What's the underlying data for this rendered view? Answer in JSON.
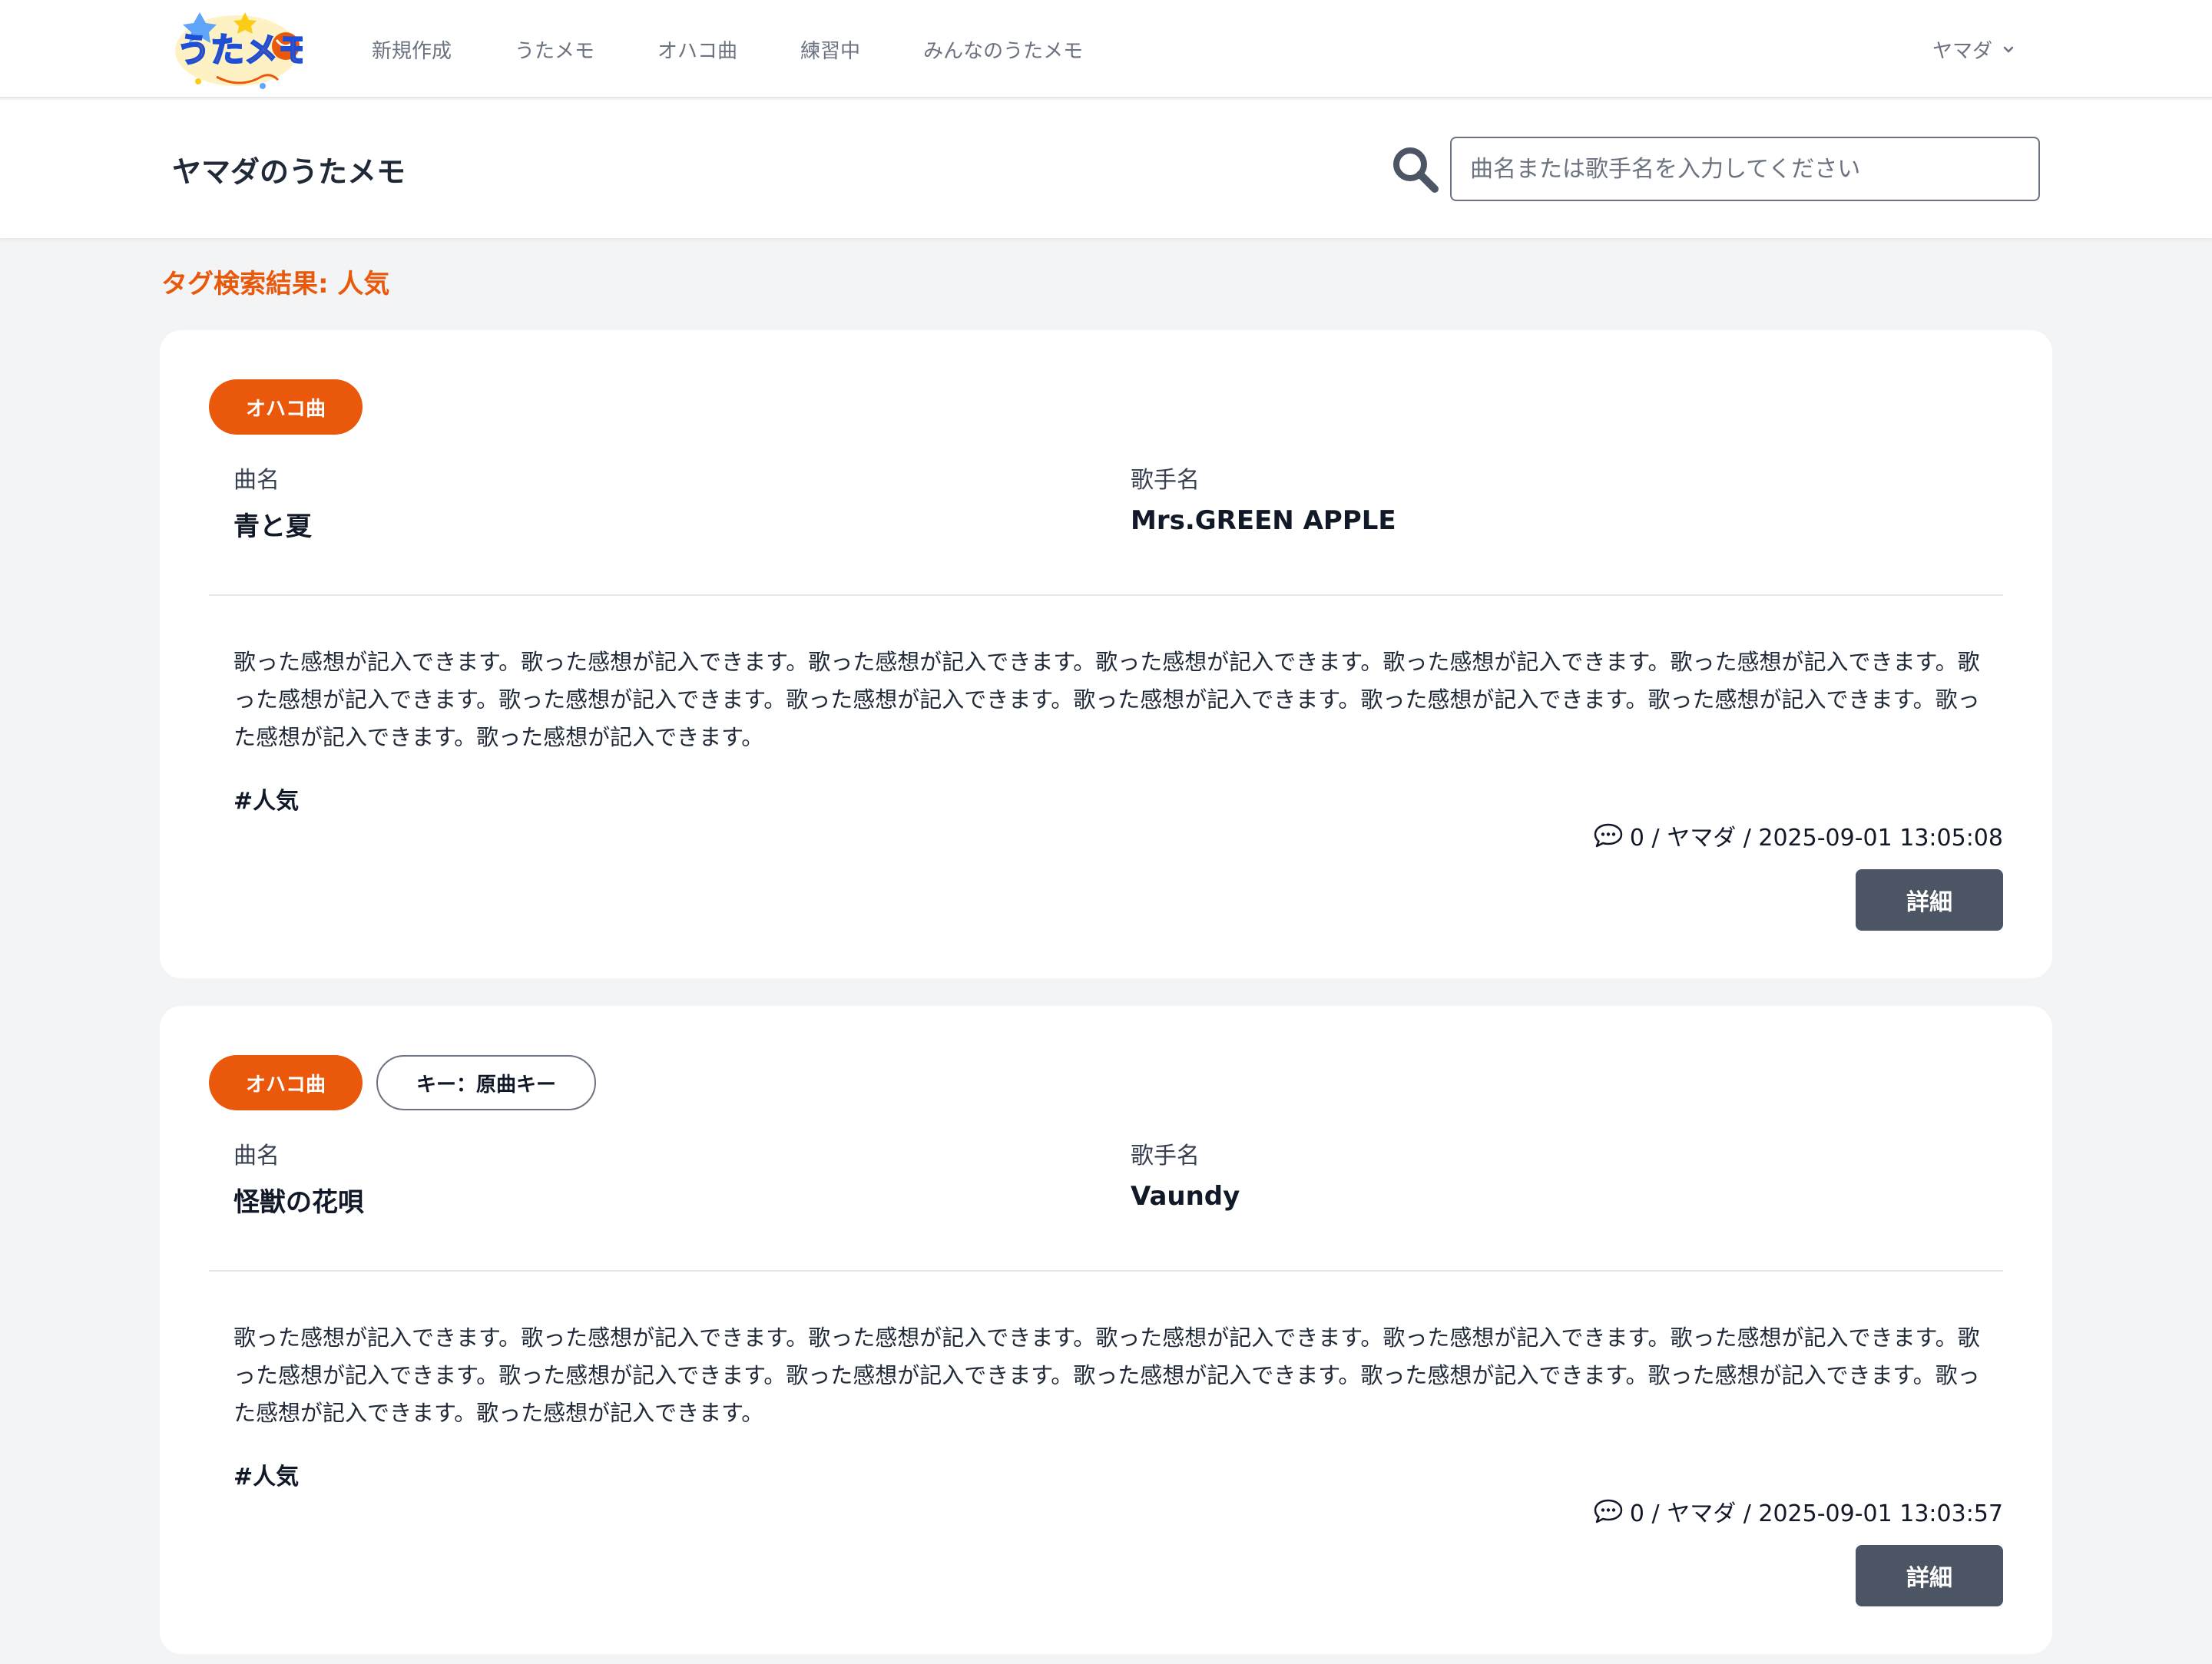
{
  "nav": {
    "logo_text": "うたメモ",
    "links": [
      "新規作成",
      "うたメモ",
      "オハコ曲",
      "練習中",
      "みんなのうたメモ"
    ],
    "user": "ヤマダ"
  },
  "header": {
    "title": "ヤマダのうたメモ",
    "search_placeholder": "曲名または歌手名を入力してください"
  },
  "result_title": "タグ検索結果: 人気",
  "labels": {
    "song": "曲名",
    "artist": "歌手名",
    "detail": "詳細"
  },
  "cards": [
    {
      "badges": [
        "オハコ曲"
      ],
      "song": "青と夏",
      "artist": "Mrs.GREEN APPLE",
      "impression": "歌った感想が記入できます。歌った感想が記入できます。歌った感想が記入できます。歌った感想が記入できます。歌った感想が記入できます。歌った感想が記入できます。歌った感想が記入できます。歌った感想が記入できます。歌った感想が記入できます。歌った感想が記入できます。歌った感想が記入できます。歌った感想が記入できます。歌った感想が記入できます。歌った感想が記入できます。",
      "tag": "#人気",
      "meta": "0 / ヤマダ / 2025-09-01 13:05:08"
    },
    {
      "badges": [
        "オハコ曲",
        "キー：原曲キー"
      ],
      "song": "怪獣の花唄",
      "artist": "Vaundy",
      "impression": "歌った感想が記入できます。歌った感想が記入できます。歌った感想が記入できます。歌った感想が記入できます。歌った感想が記入できます。歌った感想が記入できます。歌った感想が記入できます。歌った感想が記入できます。歌った感想が記入できます。歌った感想が記入できます。歌った感想が記入できます。歌った感想が記入できます。歌った感想が記入できます。歌った感想が記入できます。",
      "tag": "#人気",
      "meta": "0 / ヤマダ / 2025-09-01 13:03:57"
    }
  ],
  "colors": {
    "accent": "#ea580c",
    "button": "#4b5563",
    "background": "#f3f4f6"
  }
}
